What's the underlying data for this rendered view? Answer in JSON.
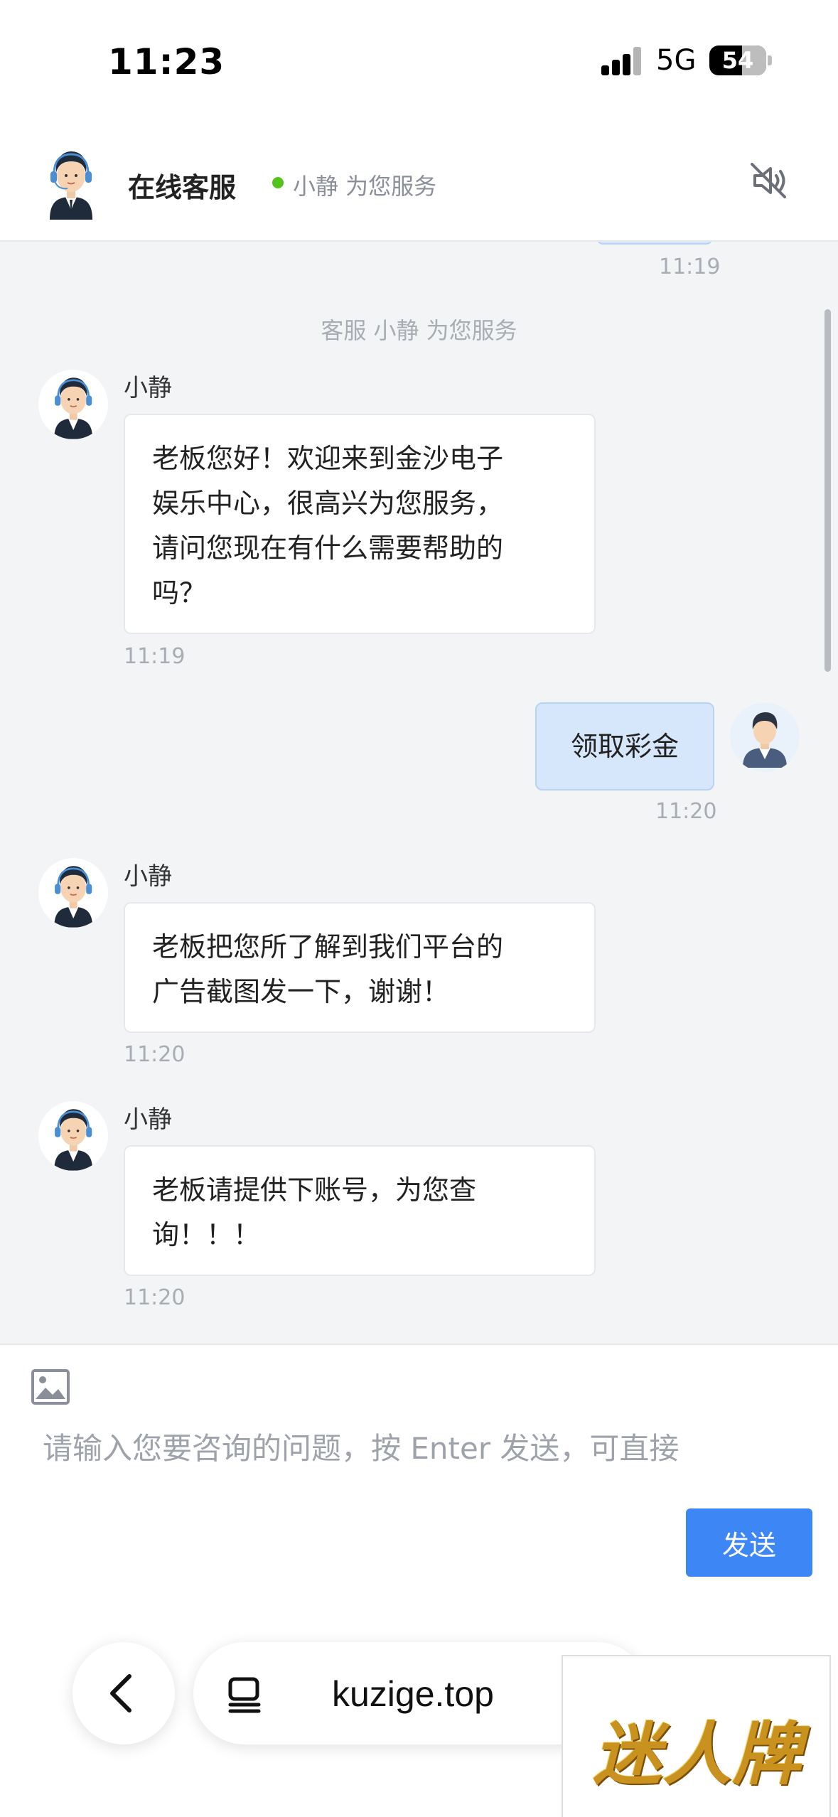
{
  "status_bar": {
    "time": "11:23",
    "network": "5G",
    "battery": "54"
  },
  "header": {
    "title": "在线客服",
    "status": "小静 为您服务"
  },
  "chat": {
    "top_time": "11:19",
    "system_notice": "客服 小静 为您服务",
    "messages": [
      {
        "side": "agent",
        "sender": "小静",
        "lines": [
          "老板您好！欢迎来到金沙电子",
          "娱乐中心，很高兴为您服务，",
          "请问您现在有什么需要帮助的",
          "吗？"
        ],
        "time": "11:19"
      },
      {
        "side": "user",
        "text": "领取彩金",
        "time": "11:20"
      },
      {
        "side": "agent",
        "sender": "小静",
        "lines": [
          "老板把您所了解到我们平台的",
          "广告截图发一下，谢谢！"
        ],
        "time": "11:20"
      },
      {
        "side": "agent",
        "sender": "小静",
        "lines": [
          "老板请提供下账号，为您查",
          "询！！！"
        ],
        "time": "11:20"
      }
    ]
  },
  "input": {
    "placeholder": "请输入您要咨询的问题，按 Enter 发送，可直接",
    "send_label": "发送"
  },
  "browser": {
    "url": "kuzige.top"
  },
  "watermark": {
    "text": "迷人牌"
  },
  "colors": {
    "accent": "#3d86f5",
    "user_bubble": "#d6e6fb",
    "online": "#52c41a",
    "chat_bg": "#f3f4f6"
  }
}
